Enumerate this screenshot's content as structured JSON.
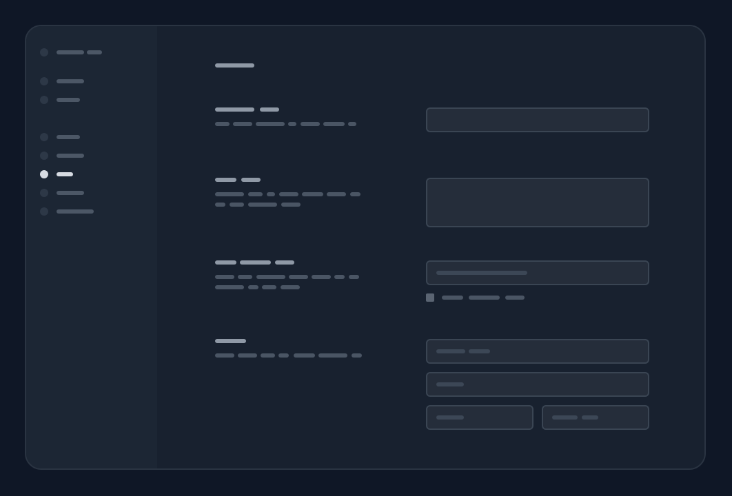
{
  "window": {
    "accent": "#d6dbe2",
    "background": "#18212f"
  },
  "sidebar": {
    "header": {
      "icon": "app-icon",
      "text": ""
    },
    "items": [
      {
        "icon": "dot-icon",
        "label": ""
      },
      {
        "icon": "dot-icon",
        "label": ""
      },
      {
        "icon": "dot-icon",
        "label": ""
      },
      {
        "icon": "dot-icon",
        "label": ""
      },
      {
        "icon": "dot-icon",
        "label": "",
        "active": true
      },
      {
        "icon": "dot-icon",
        "label": ""
      },
      {
        "icon": "dot-icon",
        "label": ""
      }
    ]
  },
  "main": {
    "page_title": "",
    "sections": [
      {
        "title": "",
        "description": "",
        "field_value": ""
      },
      {
        "title": "",
        "description": "",
        "field_value": ""
      },
      {
        "title": "",
        "description": "",
        "field_value": "",
        "checkbox_label": ""
      },
      {
        "title": "",
        "description": "",
        "fields": [
          "",
          "",
          "",
          ""
        ]
      }
    ]
  }
}
